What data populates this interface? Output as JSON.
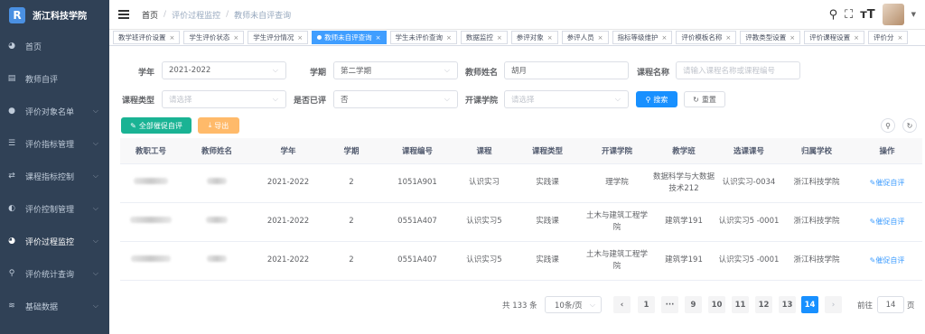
{
  "app": {
    "logo_text": "浙江科技学院",
    "logo_mark": "R"
  },
  "sidebar": {
    "items": [
      {
        "icon": "dashboard-icon",
        "glyph": "◕",
        "label": "首页",
        "has_children": false
      },
      {
        "icon": "document-icon",
        "glyph": "▤",
        "label": "教师自评",
        "has_children": false
      },
      {
        "icon": "user-icon",
        "glyph": "●",
        "label": "评价对象名单",
        "has_children": true
      },
      {
        "icon": "list-icon",
        "glyph": "☰",
        "label": "评价指标管理",
        "has_children": true
      },
      {
        "icon": "control-icon",
        "glyph": "⇄",
        "label": "课程指标控制",
        "has_children": true
      },
      {
        "icon": "toggle-icon",
        "glyph": "◐",
        "label": "评价控制管理",
        "has_children": true
      },
      {
        "icon": "monitor-icon",
        "glyph": "◕",
        "label": "评价过程监控",
        "has_children": true
      },
      {
        "icon": "search-icon",
        "glyph": "⚲",
        "label": "评价统计查询",
        "has_children": true
      },
      {
        "icon": "database-icon",
        "glyph": "≋",
        "label": "基础数据",
        "has_children": true
      }
    ]
  },
  "navbar": {
    "breadcrumb": [
      "首页",
      "评价过程监控",
      "教师未自评查询"
    ],
    "separator": "/"
  },
  "tags": [
    {
      "label": "教学班评价设置",
      "active": false
    },
    {
      "label": "学生评价状态",
      "active": false
    },
    {
      "label": "学生评分情况",
      "active": false
    },
    {
      "label": "教师未自评查询",
      "active": true
    },
    {
      "label": "学生未评价查询",
      "active": false
    },
    {
      "label": "数据监控",
      "active": false
    },
    {
      "label": "参评对象",
      "active": false
    },
    {
      "label": "参评人员",
      "active": false
    },
    {
      "label": "指标等级维护",
      "active": false
    },
    {
      "label": "评价模板名称",
      "active": false
    },
    {
      "label": "评教类型设置",
      "active": false
    },
    {
      "label": "评价课程设置",
      "active": false
    },
    {
      "label": "评价分",
      "active": false
    }
  ],
  "filters": {
    "year_label": "学年",
    "year_value": "2021-2022",
    "term_label": "学期",
    "term_value": "第二学期",
    "teacher_label": "教师姓名",
    "teacher_value": "胡月",
    "course_label": "课程名称",
    "course_placeholder": "请输入课程名称或课程编号",
    "type_label": "课程类型",
    "type_placeholder": "请选择",
    "evaluated_label": "是否已评",
    "evaluated_value": "否",
    "college_label": "开课学院",
    "college_placeholder": "请选择",
    "search_label": "搜索",
    "reset_label": "重置"
  },
  "actions": {
    "remind_all_label": "全部催促自评",
    "export_label": "导出"
  },
  "table": {
    "headers": [
      "教职工号",
      "教师姓名",
      "学年",
      "学期",
      "课程编号",
      "课程",
      "课程类型",
      "开课学院",
      "教学班",
      "选课课号",
      "归属学校",
      "操作"
    ],
    "rows": [
      {
        "year": "2021-2022",
        "term": "2",
        "code": "1051A901",
        "course": "认识实习",
        "type": "实践课",
        "college": "理学院",
        "class": "数据科学与大数据技术212",
        "select_code": "认识实习-0034",
        "school": "浙江科技学院",
        "op": "催促自评"
      },
      {
        "year": "2021-2022",
        "term": "2",
        "code": "0551A407",
        "course": "认识实习5",
        "type": "实践课",
        "college": "土木与建筑工程学院",
        "class": "建筑学191",
        "select_code": "认识实习5 -0001",
        "school": "浙江科技学院",
        "op": "催促自评"
      },
      {
        "year": "2021-2022",
        "term": "2",
        "code": "0551A407",
        "course": "认识实习5",
        "type": "实践课",
        "college": "土木与建筑工程学院",
        "class": "建筑学191",
        "select_code": "认识实习5 -0001",
        "school": "浙江科技学院",
        "op": "催促自评"
      }
    ]
  },
  "pagination": {
    "total_text": "共 133 条",
    "page_size": "10条/页",
    "pages": [
      "1",
      "···",
      "9",
      "10",
      "11",
      "12",
      "13",
      "14"
    ],
    "current": "14",
    "goto_label": "前往",
    "goto_value": "14",
    "unit": "页"
  },
  "colors": {
    "sidebar_bg": "#304156",
    "primary": "#1890ff",
    "success": "#1ab394",
    "warning": "#ffba6a"
  }
}
